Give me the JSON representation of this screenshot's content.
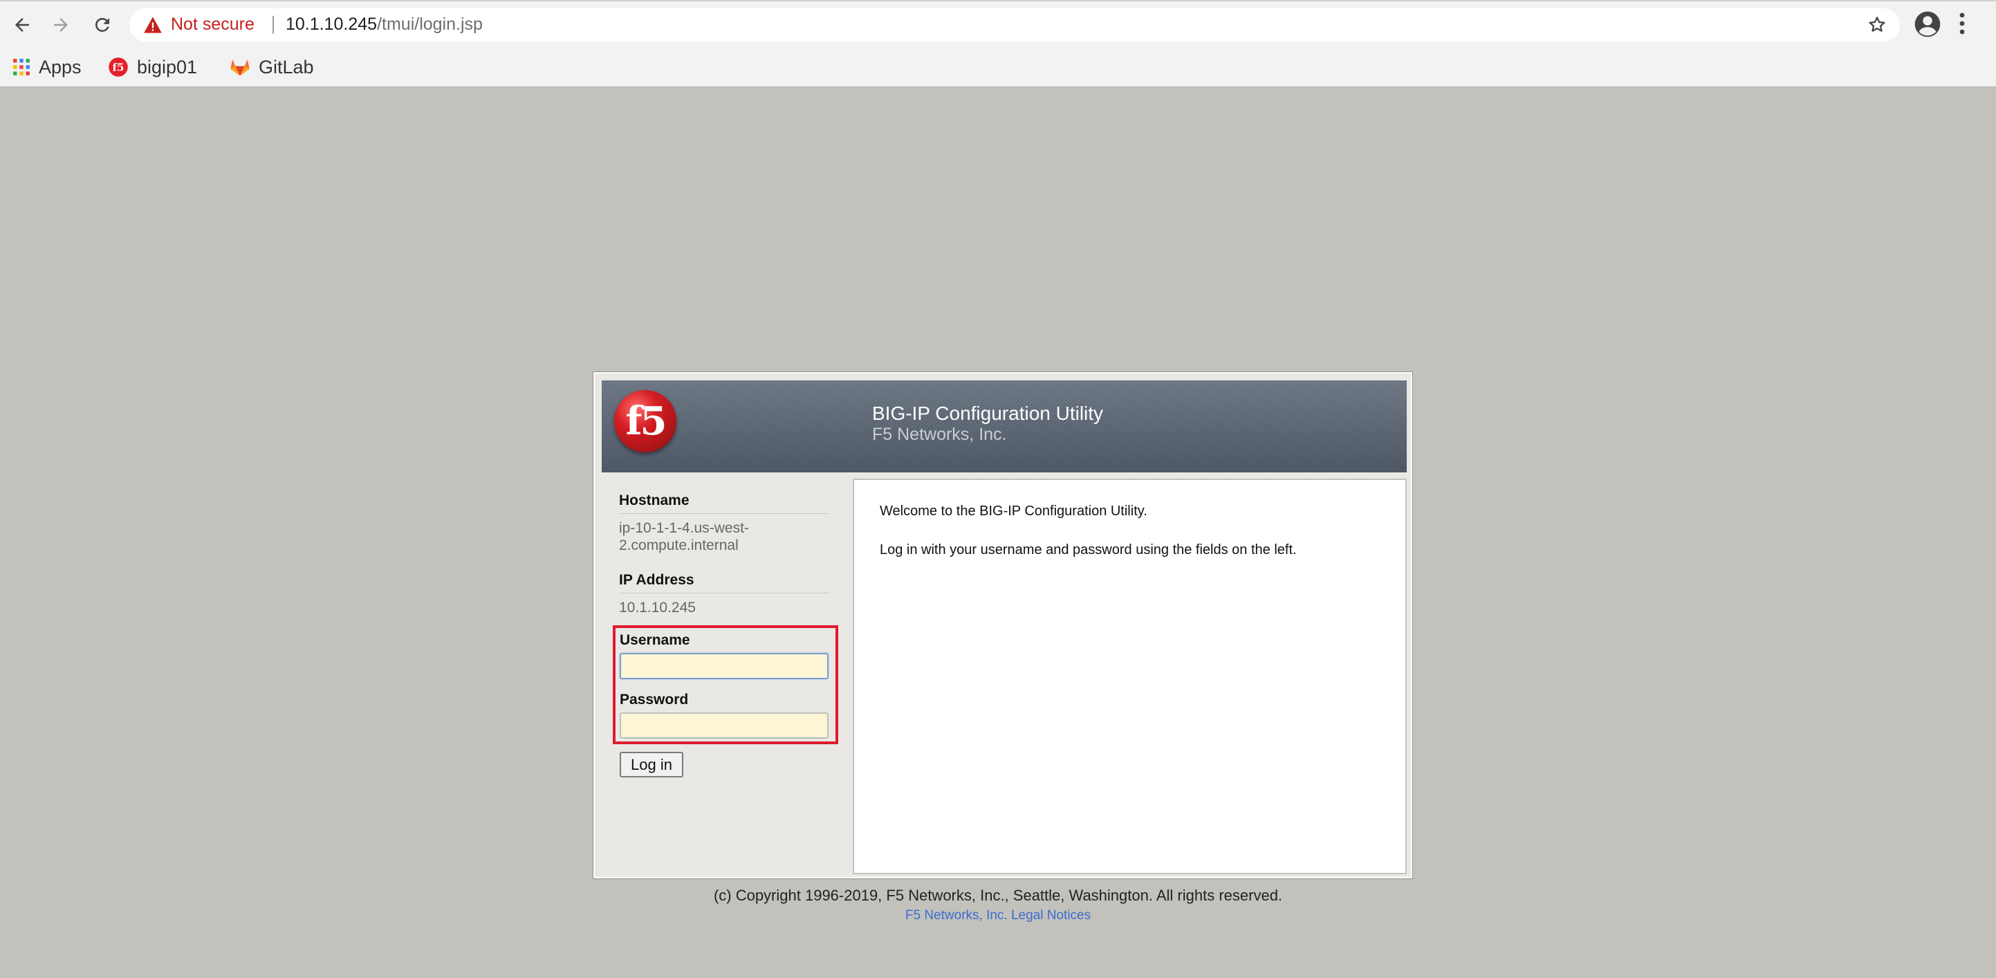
{
  "browser": {
    "security_label": "Not secure",
    "url_host": "10.1.10.245",
    "url_path": "/tmui/login.jsp",
    "bookmarks": [
      {
        "label": "Apps",
        "icon": "apps-grid-icon"
      },
      {
        "label": "bigip01",
        "icon": "f5-favicon-icon"
      },
      {
        "label": "GitLab",
        "icon": "gitlab-icon"
      }
    ]
  },
  "banner": {
    "logo_text": "f5",
    "title": "BIG-IP Configuration Utility",
    "subtitle": "F5 Networks, Inc."
  },
  "system_info": {
    "hostname_label": "Hostname",
    "hostname_value": "ip-10-1-1-4.us-west-2.compute.internal",
    "ip_label": "IP Address",
    "ip_value": "10.1.10.245"
  },
  "login": {
    "username_label": "Username",
    "username_value": "",
    "password_label": "Password",
    "password_value": "",
    "button_label": "Log in"
  },
  "content": {
    "welcome": "Welcome to the BIG-IP Configuration Utility.",
    "instructions": "Log in with your username and password using the fields on the left."
  },
  "footer": {
    "copyright": "(c) Copyright 1996-2019, F5 Networks, Inc., Seattle, Washington. All rights reserved.",
    "legal_link": "F5 Networks, Inc. Legal Notices"
  },
  "colors": {
    "page_background": "#c2c1bc",
    "highlight_box": "#e01b2f",
    "input_background": "#fdf6d4",
    "link": "#3c6ccc"
  }
}
